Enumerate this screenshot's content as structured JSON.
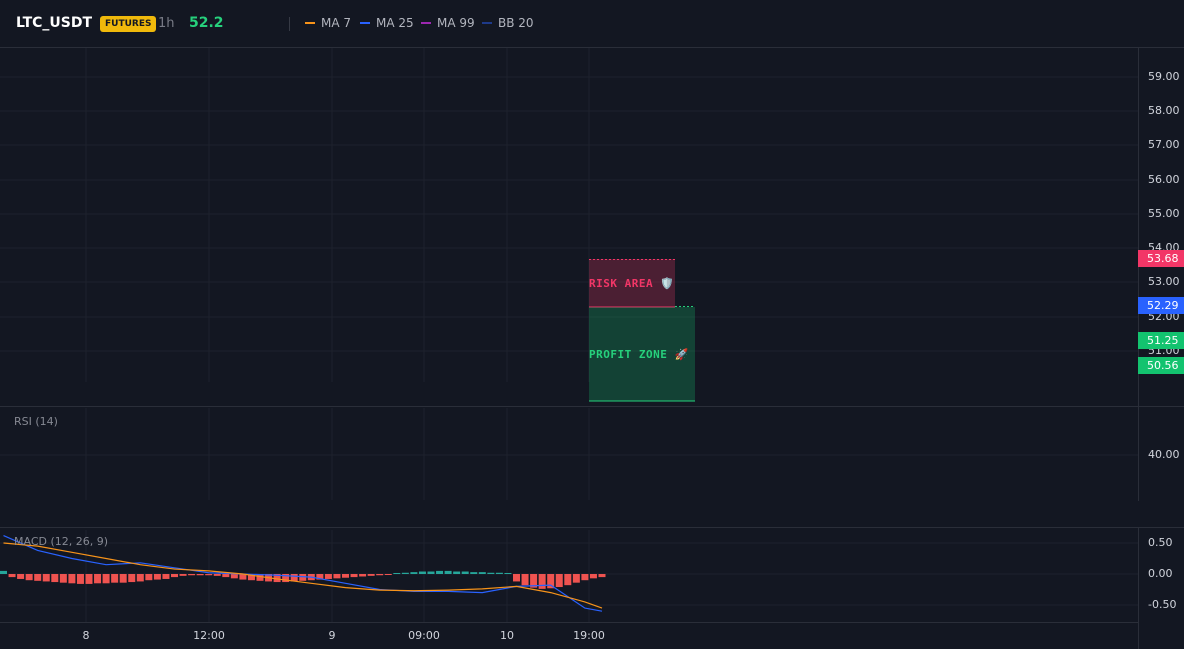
{
  "header": {
    "symbol": "LTC_USDT",
    "badge": "FUTURES",
    "interval": "1h",
    "price": "52.2",
    "legend": [
      {
        "label": "MA 7",
        "color": "#f7931a"
      },
      {
        "label": "MA 25",
        "color": "#2962ff"
      },
      {
        "label": "MA 99",
        "color": "#9c27b0"
      },
      {
        "label": "BB 20",
        "color": "#1e3a8a"
      }
    ]
  },
  "price_axis": {
    "labels": [
      "59.00",
      "58.00",
      "57.00",
      "56.00",
      "55.00",
      "54.00",
      "53.00",
      "52.00",
      "51.00"
    ],
    "tags": [
      {
        "value": "53.68",
        "color": "#f23667"
      },
      {
        "value": "52.29",
        "color": "#2962ff"
      },
      {
        "value": "51.25",
        "color": "#13c36f"
      },
      {
        "value": "50.56",
        "color": "#13c36f"
      }
    ]
  },
  "zones": {
    "risk_label": "RISK AREA 🛡️",
    "profit_label": "PROFIT ZONE 🚀",
    "risk_color": "#f23667",
    "profit_color": "#26d07c"
  },
  "rsi": {
    "title": "RSI (14)",
    "axis_labels": [
      "40.00"
    ]
  },
  "macd": {
    "title": "MACD (12, 26, 9)",
    "axis_labels": [
      "0.50",
      "0.00",
      "-0.50"
    ]
  },
  "time_axis": {
    "labels": [
      "8",
      "12:00",
      "9",
      "09:00",
      "10",
      "19:00"
    ]
  },
  "chart_data": {
    "type": "bar",
    "title": "",
    "xlabel": "",
    "ylabel": "",
    "ylim": [
      -0.75,
      0.65
    ],
    "categories": [],
    "series": [
      {
        "values": [
          0.05,
          -0.05,
          -0.08,
          -0.1,
          -0.11,
          -0.12,
          -0.13,
          -0.14,
          -0.15,
          -0.16,
          -0.16,
          -0.15,
          -0.15,
          -0.14,
          -0.14,
          -0.13,
          -0.12,
          -0.1,
          -0.09,
          -0.08,
          -0.05,
          -0.03,
          -0.02,
          -0.02,
          -0.02,
          -0.03,
          -0.05,
          -0.07,
          -0.09,
          -0.1,
          -0.11,
          -0.12,
          -0.13,
          -0.13,
          -0.12,
          -0.11,
          -0.1,
          -0.09,
          -0.08,
          -0.07,
          -0.06,
          -0.05,
          -0.04,
          -0.03,
          -0.02,
          -0.01,
          0.01,
          0.02,
          0.03,
          0.04,
          0.04,
          0.05,
          0.05,
          0.04,
          0.04,
          0.03,
          0.03,
          0.02,
          0.02,
          0.01,
          -0.12,
          -0.18,
          -0.22,
          -0.24,
          -0.23,
          -0.21,
          -0.18,
          -0.14,
          -0.1,
          -0.07,
          -0.05
        ]
      },
      {
        "x": [
          0,
          4,
          8,
          12,
          16,
          20,
          24,
          28,
          32,
          36,
          40,
          44,
          48,
          52,
          56,
          60,
          64,
          68,
          70
        ],
        "values": [
          0.62,
          0.38,
          0.25,
          0.15,
          0.18,
          0.1,
          0.02,
          0.0,
          -0.02,
          -0.05,
          -0.15,
          -0.25,
          -0.28,
          -0.28,
          -0.3,
          -0.2,
          -0.18,
          -0.55,
          -0.6
        ]
      },
      {
        "x": [
          0,
          4,
          8,
          12,
          16,
          20,
          24,
          28,
          32,
          36,
          40,
          44,
          48,
          52,
          56,
          60,
          64,
          68,
          70
        ],
        "values": [
          0.5,
          0.45,
          0.35,
          0.25,
          0.15,
          0.08,
          0.05,
          0.0,
          -0.08,
          -0.15,
          -0.22,
          -0.26,
          -0.27,
          -0.26,
          -0.24,
          -0.2,
          -0.3,
          -0.45,
          -0.55
        ]
      }
    ]
  }
}
